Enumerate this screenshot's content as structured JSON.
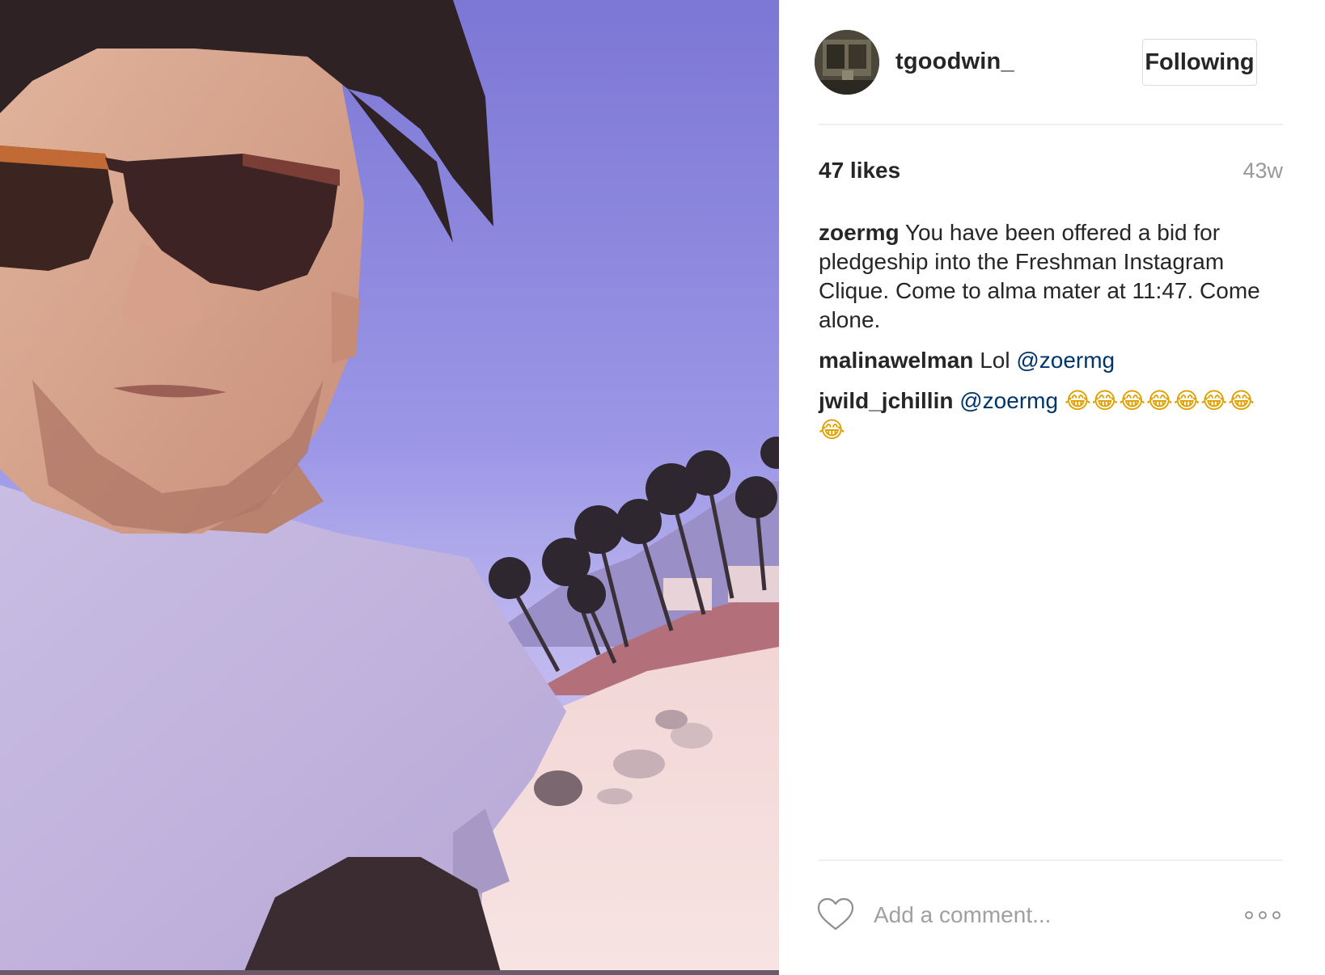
{
  "post": {
    "username": "tgoodwin_",
    "follow_label": "Following",
    "likes": "47 likes",
    "time": "43w"
  },
  "comments": [
    {
      "author": "zoermg",
      "text": "You have been offered a bid for pledgeship into the Freshman Instagram Clique. Come to alma mater at 11:47. Come alone."
    },
    {
      "author": "malinawelman",
      "text": "Lol",
      "mention": "@zoermg"
    },
    {
      "author": "jwild_jchillin",
      "mention": "@zoermg",
      "emoji": "😂😂😂😂😂😂😂😂"
    }
  ],
  "comment_box": {
    "placeholder": "Add a comment..."
  },
  "icons": {
    "like": "heart-icon",
    "more": "more-options-icon"
  },
  "colors": {
    "mention": "#003569",
    "time": "#999999",
    "button_border": "#dbdbdb"
  }
}
